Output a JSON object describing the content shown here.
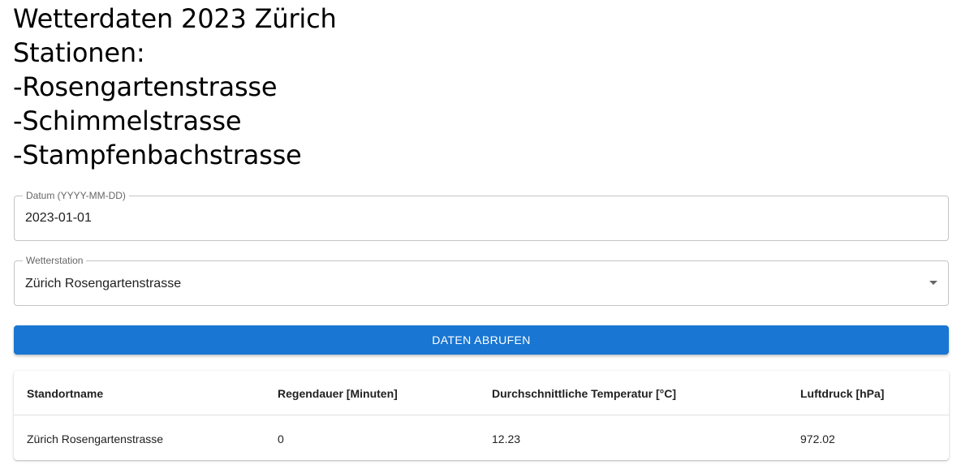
{
  "heading": {
    "lines": [
      "Wetterdaten 2023 Zürich",
      "Stationen:",
      "-Rosengartenstrasse",
      "-Schimmelstrasse",
      "-Stampfenbachstrasse"
    ]
  },
  "date_field": {
    "label": "Datum (YYYY-MM-DD)",
    "value": "2023-01-01"
  },
  "station_field": {
    "label": "Wetterstation",
    "value": "Zürich Rosengartenstrasse",
    "icon": "caret-down-icon"
  },
  "fetch_button": {
    "label": "DATEN ABRUFEN",
    "color": "#1976d2"
  },
  "table": {
    "headers": [
      "Standortname",
      "Regendauer [Minuten]",
      "Durchschnittliche Temperatur [°C]",
      "Luftdruck [hPa]"
    ],
    "rows": [
      [
        "Zürich Rosengartenstrasse",
        "0",
        "12.23",
        "972.02"
      ]
    ]
  }
}
